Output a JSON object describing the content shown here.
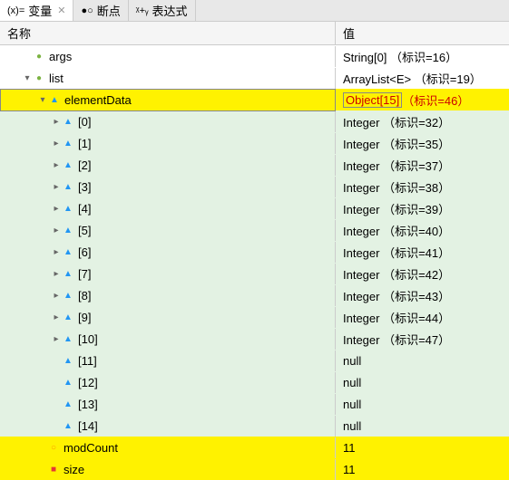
{
  "tabs": [
    {
      "icon": "(x)=",
      "label": "变量",
      "active": true
    },
    {
      "icon": "●○",
      "label": "断点",
      "active": false
    },
    {
      "icon": "ᵡ+ᵧ",
      "label": "表达式",
      "active": false
    }
  ],
  "header": {
    "name": "名称",
    "value": "值"
  },
  "rows": [
    {
      "level": 1,
      "exp": "",
      "bullet": "●",
      "bcolor": "green",
      "name": "args",
      "value": "String[0]  （标识=16）",
      "bg": ""
    },
    {
      "level": 1,
      "exp": "v",
      "bullet": "●",
      "bcolor": "green",
      "name": "list",
      "value": "ArrayList<E>  （标识=19）",
      "bg": ""
    },
    {
      "level": 2,
      "exp": "v",
      "bullet": "▲",
      "bcolor": "blue",
      "name": "elementData",
      "value": "Object[15] （标识=46）",
      "bg": "yellow",
      "selected": true,
      "redval": true
    },
    {
      "level": 3,
      "exp": ">",
      "bullet": "▲",
      "bcolor": "blue",
      "name": "[0]",
      "value": "Integer  （标识=32）",
      "bg": "green"
    },
    {
      "level": 3,
      "exp": ">",
      "bullet": "▲",
      "bcolor": "blue",
      "name": "[1]",
      "value": "Integer  （标识=35）",
      "bg": "green"
    },
    {
      "level": 3,
      "exp": ">",
      "bullet": "▲",
      "bcolor": "blue",
      "name": "[2]",
      "value": "Integer  （标识=37）",
      "bg": "green"
    },
    {
      "level": 3,
      "exp": ">",
      "bullet": "▲",
      "bcolor": "blue",
      "name": "[3]",
      "value": "Integer  （标识=38）",
      "bg": "green"
    },
    {
      "level": 3,
      "exp": ">",
      "bullet": "▲",
      "bcolor": "blue",
      "name": "[4]",
      "value": "Integer  （标识=39）",
      "bg": "green"
    },
    {
      "level": 3,
      "exp": ">",
      "bullet": "▲",
      "bcolor": "blue",
      "name": "[5]",
      "value": "Integer  （标识=40）",
      "bg": "green"
    },
    {
      "level": 3,
      "exp": ">",
      "bullet": "▲",
      "bcolor": "blue",
      "name": "[6]",
      "value": "Integer  （标识=41）",
      "bg": "green"
    },
    {
      "level": 3,
      "exp": ">",
      "bullet": "▲",
      "bcolor": "blue",
      "name": "[7]",
      "value": "Integer  （标识=42）",
      "bg": "green"
    },
    {
      "level": 3,
      "exp": ">",
      "bullet": "▲",
      "bcolor": "blue",
      "name": "[8]",
      "value": "Integer  （标识=43）",
      "bg": "green"
    },
    {
      "level": 3,
      "exp": ">",
      "bullet": "▲",
      "bcolor": "blue",
      "name": "[9]",
      "value": "Integer  （标识=44）",
      "bg": "green"
    },
    {
      "level": 3,
      "exp": ">",
      "bullet": "▲",
      "bcolor": "blue",
      "name": "[10]",
      "value": "Integer  （标识=47）",
      "bg": "green"
    },
    {
      "level": 3,
      "exp": "",
      "bullet": "▲",
      "bcolor": "blue",
      "name": "[11]",
      "value": "null",
      "bg": "green"
    },
    {
      "level": 3,
      "exp": "",
      "bullet": "▲",
      "bcolor": "blue",
      "name": "[12]",
      "value": "null",
      "bg": "green"
    },
    {
      "level": 3,
      "exp": "",
      "bullet": "▲",
      "bcolor": "blue",
      "name": "[13]",
      "value": "null",
      "bg": "green"
    },
    {
      "level": 3,
      "exp": "",
      "bullet": "▲",
      "bcolor": "blue",
      "name": "[14]",
      "value": "null",
      "bg": "green"
    },
    {
      "level": 2,
      "exp": "",
      "bullet": "○",
      "bcolor": "orange",
      "name": "modCount",
      "value": "11",
      "bg": "yellow"
    },
    {
      "level": 2,
      "exp": "",
      "bullet": "■",
      "bcolor": "red",
      "name": "size",
      "value": "11",
      "bg": "yellow"
    }
  ]
}
